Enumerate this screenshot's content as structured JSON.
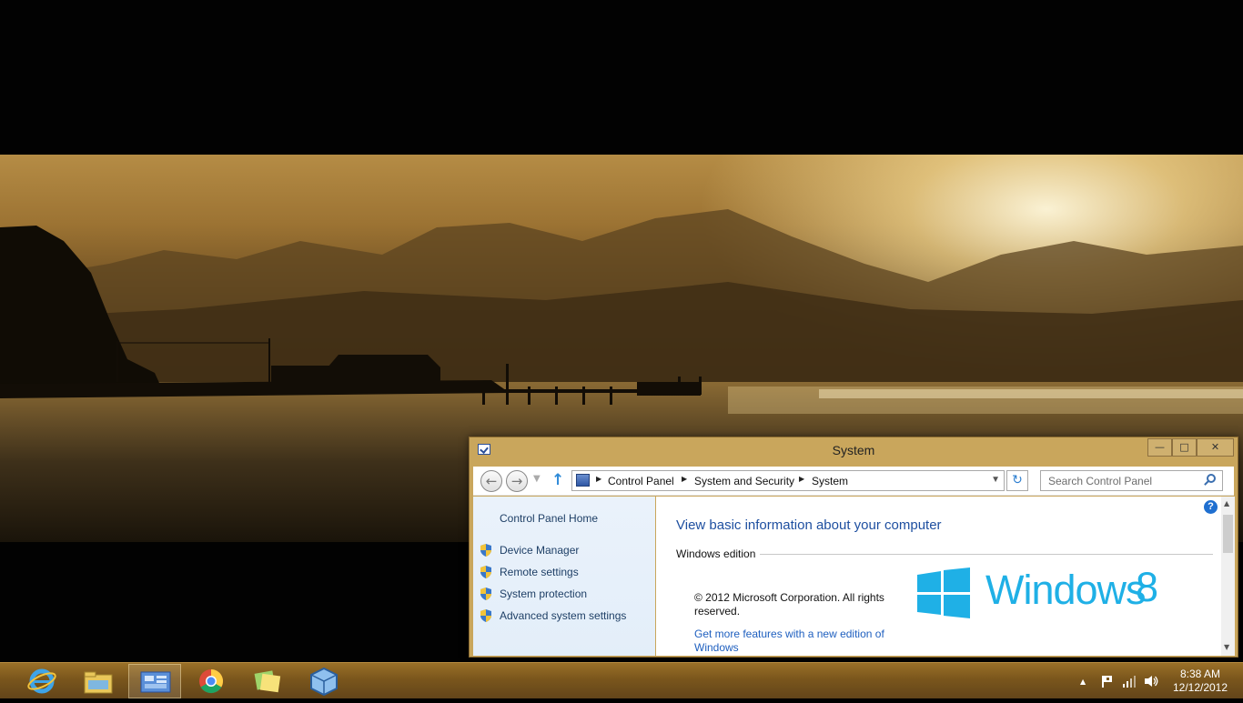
{
  "window": {
    "title": "System",
    "address_crumbs": [
      "Control Panel",
      "System and Security",
      "System"
    ],
    "search_placeholder": "Search Control Panel"
  },
  "sidebar": {
    "home": "Control Panel Home",
    "links": [
      "Device Manager",
      "Remote settings",
      "System protection",
      "Advanced system settings"
    ]
  },
  "content": {
    "heading": "View basic information about your computer",
    "section": "Windows edition",
    "copyright": "© 2012 Microsoft Corporation. All rights reserved.",
    "more_link": "Get more features with a new edition of Windows",
    "logo_text": "Windows",
    "logo_number": "8",
    "help_label": "?"
  },
  "taskbar": {
    "pinned": [
      "internet-explorer-icon",
      "file-explorer-icon",
      "control-panel-icon",
      "chrome-icon",
      "sticky-notes-icon",
      "virtualbox-icon"
    ],
    "clock_time": "8:38 AM",
    "clock_date": "12/12/2012"
  },
  "colors": {
    "accent": "#1fb0e6",
    "link": "#1e5fbf",
    "window_frame": "#c9a65c",
    "taskbar": "#7a561c"
  }
}
